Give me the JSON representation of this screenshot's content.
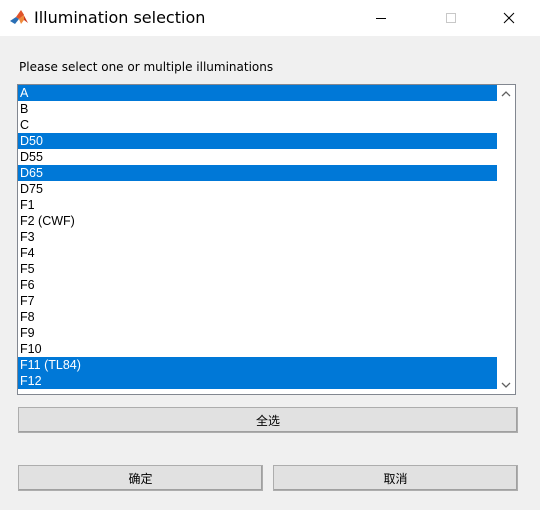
{
  "window": {
    "title": "Illumination selection",
    "icon": "matlab-icon"
  },
  "prompt": "Please select one or multiple illuminations",
  "listbox": {
    "items": [
      {
        "label": "A",
        "selected": true
      },
      {
        "label": "B",
        "selected": false
      },
      {
        "label": "C",
        "selected": false
      },
      {
        "label": "D50",
        "selected": true
      },
      {
        "label": "D55",
        "selected": false
      },
      {
        "label": "D65",
        "selected": true
      },
      {
        "label": "D75",
        "selected": false
      },
      {
        "label": "F1",
        "selected": false
      },
      {
        "label": "F2 (CWF)",
        "selected": false
      },
      {
        "label": "F3",
        "selected": false
      },
      {
        "label": "F4",
        "selected": false
      },
      {
        "label": "F5",
        "selected": false
      },
      {
        "label": "F6",
        "selected": false
      },
      {
        "label": "F7",
        "selected": false
      },
      {
        "label": "F8",
        "selected": false
      },
      {
        "label": "F9",
        "selected": false
      },
      {
        "label": "F10",
        "selected": false
      },
      {
        "label": "F11 (TL84)",
        "selected": true
      },
      {
        "label": "F12",
        "selected": true
      }
    ]
  },
  "buttons": {
    "select_all": "全选",
    "ok": "确定",
    "cancel": "取消"
  },
  "colors": {
    "selection": "#0078d7",
    "window_bg": "#f0f0f0",
    "button_bg": "#e1e1e1"
  }
}
